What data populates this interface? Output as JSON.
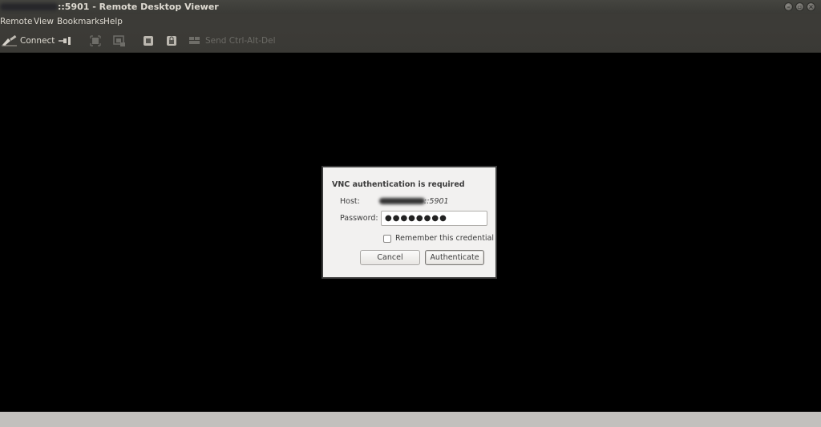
{
  "window": {
    "title": "::5901 - Remote Desktop Viewer"
  },
  "menubar": {
    "items": [
      "Remote",
      "View",
      "Bookmarks",
      "Help"
    ]
  },
  "toolbar": {
    "connect_label": "Connect",
    "send_cad_label": "Send Ctrl-Alt-Del"
  },
  "dialog": {
    "title": "VNC authentication is required",
    "host_label": "Host:",
    "host_value": "::5901",
    "password_label": "Password:",
    "password_value": "●●●●●●●●",
    "remember_label": "Remember this credential",
    "remember_checked": false,
    "cancel_label": "Cancel",
    "authenticate_label": "Authenticate"
  }
}
